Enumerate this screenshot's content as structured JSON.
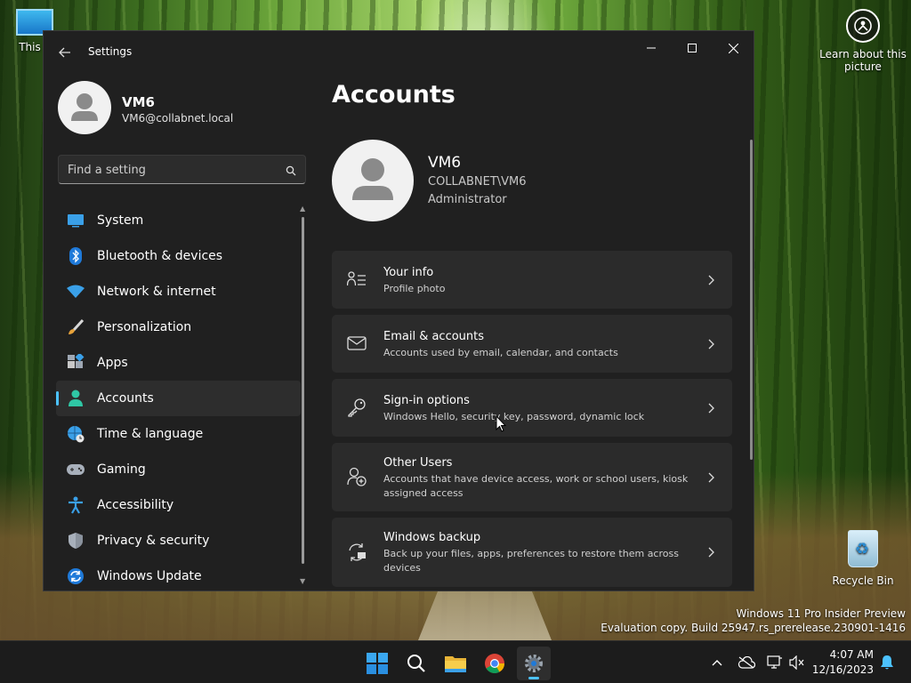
{
  "desktop": {
    "this_pc_label": "This P",
    "learn_label": "Learn about this picture",
    "recycle_label": "Recycle Bin",
    "watermark_line1": "Windows 11 Pro Insider Preview",
    "watermark_line2": "Evaluation copy. Build 25947.rs_prerelease.230901-1416"
  },
  "window": {
    "app_title": "Settings",
    "controls": {
      "minimize": "minimize-icon",
      "maximize": "maximize-icon",
      "close": "close-icon"
    }
  },
  "profile": {
    "name": "VM6",
    "email": "VM6@collabnet.local"
  },
  "search": {
    "placeholder": "Find a setting",
    "value": ""
  },
  "nav": {
    "items": [
      {
        "label": "System",
        "icon": "system-icon"
      },
      {
        "label": "Bluetooth & devices",
        "icon": "bluetooth-icon"
      },
      {
        "label": "Network & internet",
        "icon": "wifi-icon"
      },
      {
        "label": "Personalization",
        "icon": "brush-icon"
      },
      {
        "label": "Apps",
        "icon": "apps-icon"
      },
      {
        "label": "Accounts",
        "icon": "person-icon",
        "active": true
      },
      {
        "label": "Time & language",
        "icon": "globe-clock-icon"
      },
      {
        "label": "Gaming",
        "icon": "gamepad-icon"
      },
      {
        "label": "Accessibility",
        "icon": "accessibility-icon"
      },
      {
        "label": "Privacy & security",
        "icon": "shield-icon"
      },
      {
        "label": "Windows Update",
        "icon": "update-icon"
      }
    ]
  },
  "main": {
    "title": "Accounts",
    "user": {
      "name": "VM6",
      "domain": "COLLABNET\\VM6",
      "role": "Administrator"
    },
    "cards": [
      {
        "title": "Your info",
        "subtitle": "Profile photo",
        "icon": "person-list-icon"
      },
      {
        "title": "Email & accounts",
        "subtitle": "Accounts used by email, calendar, and contacts",
        "icon": "mail-icon"
      },
      {
        "title": "Sign-in options",
        "subtitle": "Windows Hello, security key, password, dynamic lock",
        "icon": "key-icon"
      },
      {
        "title": "Other Users",
        "subtitle": "Accounts that have device access, work or school users, kiosk assigned access",
        "icon": "person-add-icon"
      },
      {
        "title": "Windows backup",
        "subtitle": "Back up your files, apps, preferences to restore them across devices",
        "icon": "backup-icon"
      }
    ]
  },
  "taskbar": {
    "apps": [
      "start-icon",
      "search-icon",
      "file-explorer-icon",
      "chrome-icon",
      "settings-icon"
    ],
    "clock_time": "4:07 AM",
    "clock_date": "12/16/2023"
  },
  "colors": {
    "accent": "#4cc2ff",
    "window_bg": "#202020",
    "card_bg": "#2b2b2b"
  }
}
